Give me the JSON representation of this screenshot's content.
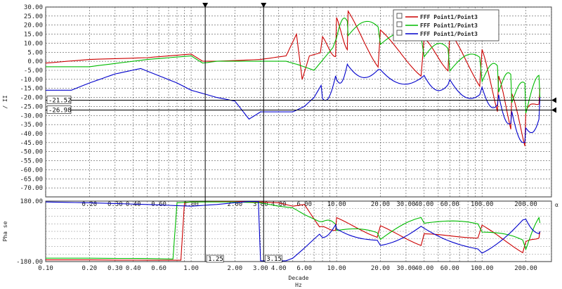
{
  "chart_data": [
    {
      "type": "line",
      "panel": "magnitude",
      "ylabel": "/ II",
      "ylim": [
        -75,
        30
      ],
      "y_ticks": [
        "30.00",
        "25.00",
        "20.00",
        "15.00",
        "10.00",
        "5.00",
        "0.00",
        "-5.00",
        "-10.00",
        "-15.00",
        "-20.00",
        "-25.00",
        "-30.00",
        "-35.00",
        "-40.00",
        "-45.00",
        "-50.00",
        "-55.00",
        "-60.00",
        "-65.00",
        "-70.00"
      ],
      "x_scale": "log",
      "xlim": [
        0.1,
        300
      ],
      "grid": true,
      "legend": {
        "placement": "top-right",
        "items": [
          {
            "label": "FFF Point1/Point3",
            "color": "#cc0000"
          },
          {
            "label": "FFF Point1/Point3",
            "color": "#00bb00"
          },
          {
            "label": "FFF Point1/Point3",
            "color": "#0000cc"
          }
        ]
      },
      "cursor_values": [
        "-21.52",
        "-26.98"
      ],
      "series": [
        {
          "color": "#cc0000",
          "x": [
            0.1,
            0.2,
            0.5,
            1.0,
            1.2,
            1.5,
            3,
            4.5,
            5.3,
            5.8,
            6.5,
            8,
            10,
            12,
            20,
            40,
            60,
            100,
            130,
            160,
            200,
            250
          ],
          "y": [
            -1,
            1,
            2,
            4,
            0,
            0,
            1,
            3,
            15,
            -10,
            3,
            5,
            15,
            18,
            7,
            2,
            5,
            -5,
            -20,
            -30,
            -40,
            -15
          ]
        },
        {
          "color": "#00bb00",
          "x": [
            0.1,
            0.2,
            0.5,
            1.0,
            1.2,
            1.5,
            3,
            4.5,
            5.5,
            7,
            10,
            12,
            20,
            40,
            60,
            100,
            130,
            160,
            200,
            250
          ],
          "y": [
            -3,
            -3,
            1,
            3,
            -1,
            0,
            0,
            0,
            -2,
            -5,
            10,
            12,
            8,
            2,
            -5,
            -10,
            -15,
            -20,
            -25,
            -20
          ]
        },
        {
          "color": "#0000cc",
          "x": [
            0.1,
            0.15,
            0.2,
            0.3,
            0.45,
            0.6,
            0.8,
            1.0,
            1.5,
            2.0,
            2.5,
            3.0,
            4.0,
            5.0,
            6.0,
            7.0,
            8.0,
            10,
            12,
            20,
            40,
            60,
            100,
            130,
            160,
            200,
            250
          ],
          "y": [
            -16,
            -16,
            -12,
            -7,
            -4,
            -8,
            -12,
            -16,
            -20,
            -22,
            -32,
            -28,
            -28,
            -28,
            -25,
            -20,
            -12,
            -2,
            5,
            2,
            -2,
            -5,
            -10,
            -15,
            -25,
            -35,
            -20
          ]
        }
      ]
    },
    {
      "type": "line",
      "panel": "phase",
      "ylabel": "Pha se",
      "ylim": [
        -180,
        180
      ],
      "y_ticks": [
        "180.00",
        "-180.00"
      ],
      "x_scale": "log",
      "xlim": [
        0.1,
        300
      ],
      "grid": true,
      "x_ticks": [
        "0.10",
        "0.20",
        "0.30",
        "0.40",
        "0.60",
        "1.00",
        "2.00",
        "3.00",
        "4.00",
        "6.00",
        "10.00",
        "20.00",
        "30.00",
        "40.00",
        "60.00",
        "100.00",
        "200.00"
      ],
      "top_tick_labels": [
        "0.20",
        "0.30",
        "0.40",
        "0.60",
        "1.00",
        "2.00",
        "3.00",
        "4.00",
        "6.00",
        "10.00",
        "20.00",
        "30.00",
        "40.00",
        "60.00",
        "100.00",
        "200.00"
      ],
      "xlabel_line1": "Decade",
      "xlabel_line2": "Hz",
      "cursor_values": [
        "1.25",
        "3.15"
      ],
      "right_marker": "α",
      "series": [
        {
          "color": "#cc0000",
          "x": [
            0.1,
            0.2,
            0.5,
            0.85,
            0.9,
            1.0,
            2,
            3,
            4,
            5,
            6,
            8,
            10,
            20,
            40,
            100,
            200,
            250
          ],
          "y": [
            -170,
            -170,
            -172,
            -172,
            170,
            175,
            178,
            175,
            170,
            150,
            160,
            0,
            50,
            0,
            -50,
            0,
            -100,
            0
          ]
        },
        {
          "color": "#00bb00",
          "x": [
            0.1,
            0.2,
            0.5,
            0.75,
            0.8,
            1.0,
            2,
            3,
            4,
            5,
            6,
            8,
            10,
            20,
            40,
            100,
            200,
            250
          ],
          "y": [
            -160,
            -160,
            -162,
            -165,
            170,
            175,
            175,
            170,
            150,
            140,
            100,
            50,
            0,
            -50,
            50,
            0,
            -100,
            50
          ]
        },
        {
          "color": "#0000cc",
          "x": [
            0.1,
            0.2,
            0.5,
            1.0,
            1.5,
            2.5,
            2.9,
            3.0,
            3.5,
            4.5,
            5,
            6,
            8,
            10,
            20,
            40,
            100,
            200,
            250
          ],
          "y": [
            175,
            170,
            160,
            150,
            160,
            178,
            178,
            -175,
            -178,
            -175,
            -160,
            -100,
            0,
            50,
            -50,
            50,
            -100,
            100,
            0
          ]
        }
      ]
    }
  ]
}
